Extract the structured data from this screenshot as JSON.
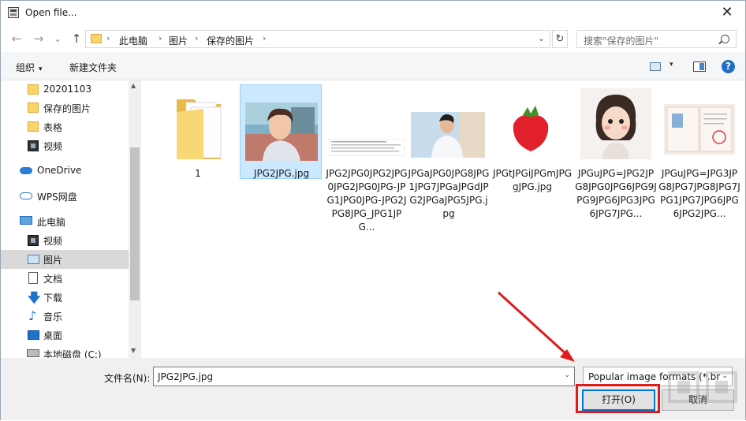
{
  "window": {
    "title": "Open file...",
    "close_glyph": "✕"
  },
  "nav": {
    "back_glyph": "←",
    "forward_glyph": "→",
    "recent_glyph": "⌄",
    "up_glyph": "↑"
  },
  "address": {
    "items": [
      "此电脑",
      "图片",
      "保存的图片"
    ],
    "separator": "›",
    "dropdown_glyph": "⌄",
    "refresh_glyph": "↻"
  },
  "search": {
    "placeholder": "搜索\"保存的图片\""
  },
  "toolbar": {
    "organize_label": "组织",
    "caret": "▾",
    "new_folder_label": "新建文件夹",
    "help_label": "?"
  },
  "sidebar": {
    "items": [
      {
        "label": "20201103",
        "icon": "folder-icon"
      },
      {
        "label": "保存的图片",
        "icon": "folder-icon"
      },
      {
        "label": "表格",
        "icon": "folder-icon"
      },
      {
        "label": "视频",
        "icon": "video-icon"
      },
      {
        "label": "OneDrive",
        "icon": "cloud-icon"
      },
      {
        "label": "WPS网盘",
        "icon": "wps-cloud-icon"
      },
      {
        "label": "此电脑",
        "icon": "computer-icon"
      },
      {
        "label": "视频",
        "icon": "video-icon"
      },
      {
        "label": "图片",
        "icon": "pictures-icon"
      },
      {
        "label": "文档",
        "icon": "document-icon"
      },
      {
        "label": "下载",
        "icon": "download-icon"
      },
      {
        "label": "音乐",
        "icon": "music-icon"
      },
      {
        "label": "桌面",
        "icon": "desktop-icon"
      },
      {
        "label": "本地磁盘 (C:)",
        "icon": "disk-icon"
      }
    ],
    "selected_index": 8,
    "download_glyph": "🡇",
    "music_glyph": "♪"
  },
  "files": [
    {
      "name": "1",
      "kind": "folder"
    },
    {
      "name": "JPG2JPG.jpg",
      "kind": "image"
    },
    {
      "name": "JPG2JPG0JPG2JPG0JPG2JPG0JPG-JPG1JPG0JPG-JPG2JPG8JPG_JPG1JPG...",
      "kind": "image"
    },
    {
      "name": "JPGaJPG0JPG8JPG1JPG7JPGaJPGdJPG2JPGaJPG5JPG.jpg",
      "kind": "image"
    },
    {
      "name": "JPGtJPGiJPGmJPGgJPG.jpg",
      "kind": "image"
    },
    {
      "name": "JPGuJPG=JPG2JPG8JPG0JPG6JPG9JPG9JPG6JPG3JPG6JPG7JPG...",
      "kind": "image"
    },
    {
      "name": "JPGuJPG=JPG3JPG8JPG7JPG8JPG7JPG1JPG7JPG6JPG6JPG2JPG...",
      "kind": "image"
    }
  ],
  "bottom": {
    "filename_label": "文件名(N):",
    "filename_value": "JPG2JPG.jpg",
    "dropdown_glyph": "⌄",
    "filter_value": "Popular image formats (*.bm",
    "open_label": "打开(O)",
    "cancel_label": "取消"
  },
  "colors": {
    "selection": "#cce8ff",
    "annotation_red": "#e01b1b",
    "accent_blue": "#0078d7"
  }
}
